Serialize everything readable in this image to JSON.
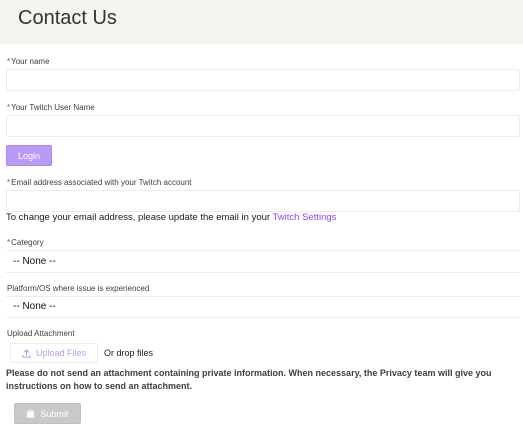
{
  "header": {
    "title": "Contact Us"
  },
  "form": {
    "required_marker": "*",
    "name_label": "Your name",
    "name_value": "",
    "twitch_username_label": "Your Twitch User Name",
    "twitch_username_value": "",
    "login_label": "Login",
    "email_label": "Email address associated with your Twitch account",
    "email_value": "",
    "email_info_prefix": "To change your email address, please update the email in your ",
    "email_info_link": "Twitch Settings",
    "category_label": "Category",
    "category_value": "-- None --",
    "platform_label": "Platform/OS where issue is experienced",
    "platform_value": "-- None --",
    "attachment_label": "Upload Attachment",
    "upload_label": "Upload Files",
    "drop_label": "Or drop files",
    "privacy_warning": "Please do not send an attachment containing private information. When necessary, the Privacy team will give you instructions on how to send an attachment.",
    "submit_label": "Submit"
  },
  "colors": {
    "header_bg": "#f5f4f1",
    "accent_purple": "#9146ff",
    "login_button": "#b99af7",
    "required_red": "#c23934",
    "submit_disabled": "#c9c9c9"
  },
  "icons": {
    "upload": "upload-icon",
    "submit": "lock-icon"
  }
}
